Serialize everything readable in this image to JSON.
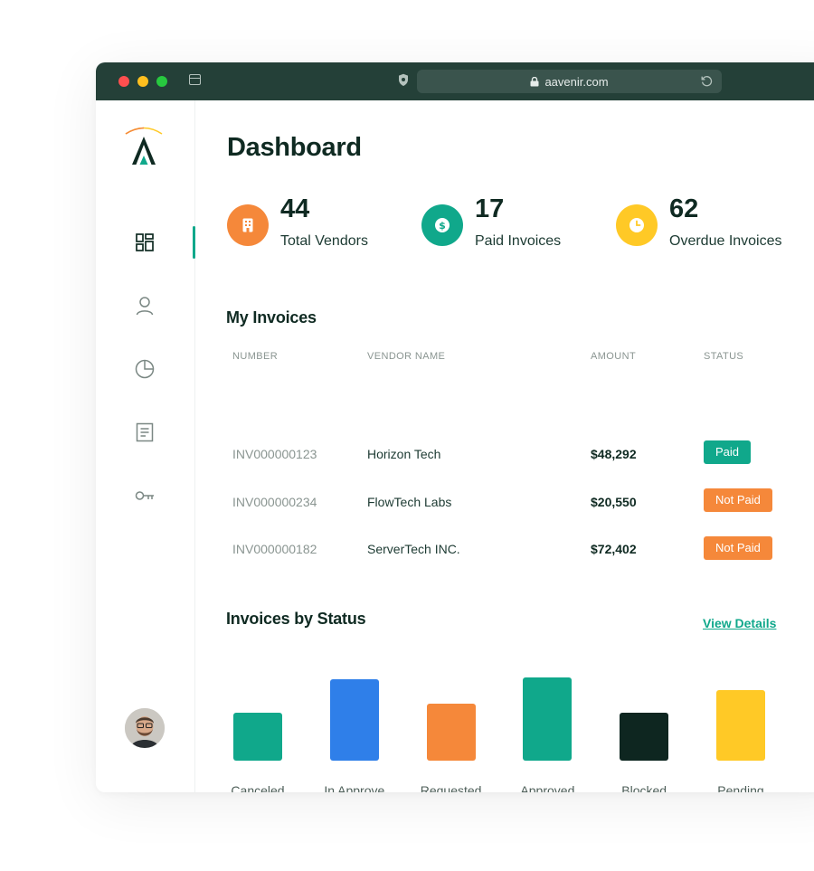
{
  "browser": {
    "url": "aavenir.com"
  },
  "sidebar": {
    "nav": [
      {
        "name": "dashboard-icon",
        "active": true
      },
      {
        "name": "user-icon",
        "active": false
      },
      {
        "name": "pie-chart-icon",
        "active": false
      },
      {
        "name": "document-icon",
        "active": false
      },
      {
        "name": "key-icon",
        "active": false
      }
    ]
  },
  "page": {
    "title": "Dashboard"
  },
  "stats": [
    {
      "value": "44",
      "label": "Total Vendors",
      "color": "#f5883a",
      "icon": "building-icon"
    },
    {
      "value": "17",
      "label": "Paid Invoices",
      "color": "#10a88b",
      "icon": "dollar-icon"
    },
    {
      "value": "62",
      "label": "Overdue Invoices",
      "color": "#ffc926",
      "icon": "clock-icon"
    }
  ],
  "invoices": {
    "title": "My Invoices",
    "columns": [
      "NUMBER",
      "VENDOR NAME",
      "AMOUNT",
      "STATUS"
    ],
    "rows": [
      {
        "number": "INV000000123",
        "vendor": "Horizon Tech",
        "amount": "$48,292",
        "status": "Paid",
        "status_color": "#10a88b"
      },
      {
        "number": "INV000000234",
        "vendor": "FlowTech Labs",
        "amount": "$20,550",
        "status": "Not Paid",
        "status_color": "#f5883a"
      },
      {
        "number": "INV000000182",
        "vendor": "ServerTech INC.",
        "amount": "$72,402",
        "status": "Not Paid",
        "status_color": "#f5883a"
      }
    ]
  },
  "status_chart": {
    "title": "Invoices by  Status",
    "view_details": "View Details"
  },
  "chart_data": {
    "type": "bar",
    "categories": [
      "Canceled",
      "In Approve",
      "Requested",
      "Approved",
      "Blocked",
      "Pending"
    ],
    "values": [
      53,
      90,
      63,
      92,
      53,
      78
    ],
    "colors": [
      "#10a88b",
      "#2f7fe9",
      "#f5883a",
      "#10a88b",
      "#0e2620",
      "#ffc926"
    ],
    "axes": "none",
    "grid": false
  }
}
